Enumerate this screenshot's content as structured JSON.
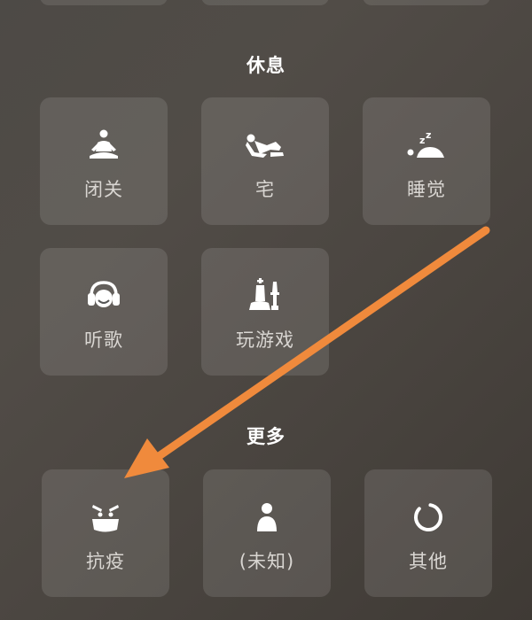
{
  "sections": {
    "rest": {
      "title": "休息"
    },
    "more": {
      "title": "更多"
    }
  },
  "tiles": {
    "retreat": {
      "label": "闭关",
      "icon": "meditation-icon"
    },
    "home": {
      "label": "宅",
      "icon": "lounging-icon"
    },
    "sleep": {
      "label": "睡觉",
      "icon": "sleep-icon"
    },
    "music": {
      "label": "听歌",
      "icon": "headphones-icon"
    },
    "gaming": {
      "label": "玩游戏",
      "icon": "chess-pieces-icon"
    },
    "epidemic": {
      "label": "抗疫",
      "icon": "face-mask-icon"
    },
    "unknown": {
      "label": "(未知)",
      "icon": "person-icon"
    },
    "other": {
      "label": "其他",
      "icon": "loading-ring-icon"
    }
  },
  "colors": {
    "background": "#4d4a46",
    "tile": "rgba(255,255,255,0.115)",
    "label": "#d9d6d2",
    "icon": "#ffffff",
    "annotation_arrow": "#f08a3c"
  }
}
